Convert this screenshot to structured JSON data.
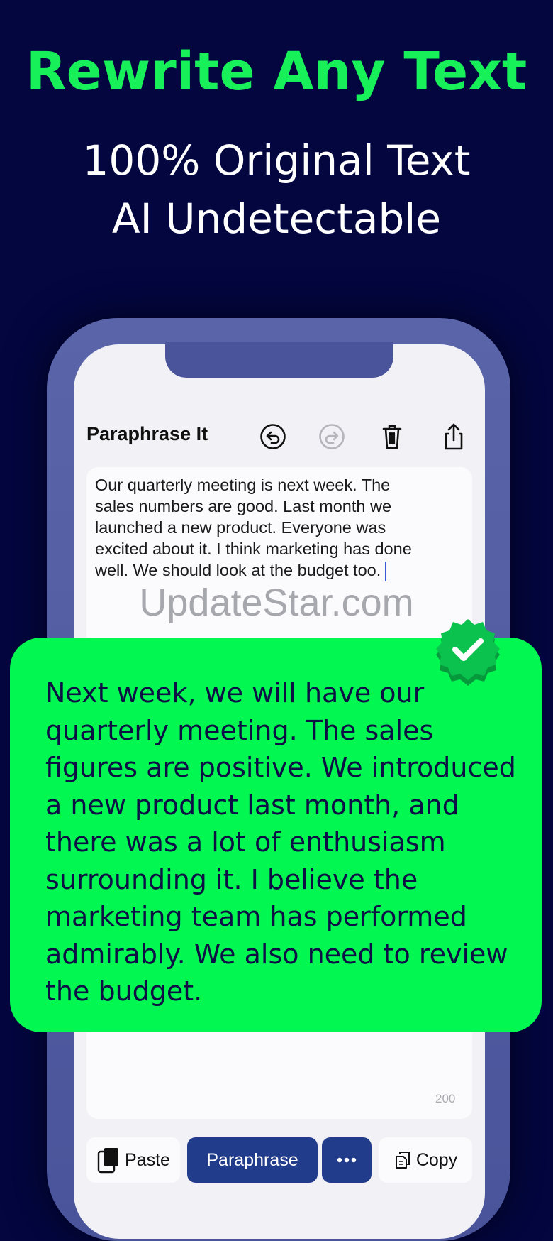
{
  "headline": "Rewrite Any Text",
  "subline1": "100% Original Text",
  "subline2": "AI Undetectable",
  "app": {
    "title": "Paraphrase It",
    "toolbar_icons": [
      "undo-icon",
      "redo-icon",
      "trash-icon",
      "share-icon"
    ]
  },
  "input": {
    "text": "Our quarterly meeting is next week. The sales numbers are good. Last month we launched a new product. Everyone was excited about it. I think marketing has done well. We should look at the budget too.",
    "lines": [
      "Our quarterly meeting is next week. The",
      "sales numbers are good. Last month we",
      "launched a new product. Everyone was",
      "excited about it. I think marketing has done",
      "well. We should look at the budget too."
    ],
    "char_count": "200"
  },
  "watermark": "UpdateStar.com",
  "result": {
    "lines": [
      "Next week, we will have our",
      "quarterly meeting. The sales",
      "figures are positive. We introduced",
      "a new product last month, and",
      "there was a lot of enthusiasm",
      "surrounding it. I believe the",
      "marketing team has performed",
      "admirably. We also need to review",
      "the budget."
    ]
  },
  "buttons": {
    "paste": "Paste",
    "paraphrase": "Paraphrase",
    "more_icon": "ellipsis-icon",
    "copy": "Copy"
  },
  "colors": {
    "background": "#03063f",
    "headline": "#18f05a",
    "result_card": "#03f751",
    "primary_button": "#223c8c",
    "phone_frame": "#4a549a"
  }
}
